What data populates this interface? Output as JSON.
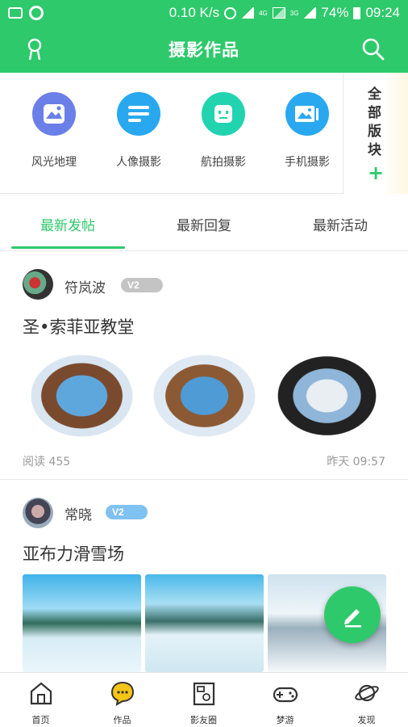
{
  "status_bar": {
    "speed": "0.10 K/s",
    "net1": "4G",
    "net2": "3G",
    "battery": "74%",
    "time": "09:24"
  },
  "header": {
    "title": "摄影作品",
    "left_icon": "user-icon",
    "right_icon": "search-icon",
    "color": "#2ec96b"
  },
  "categories": [
    {
      "label": "风光地理",
      "icon": "landscape-icon",
      "color": "#6b7fe8"
    },
    {
      "label": "人像摄影",
      "icon": "lines-icon",
      "color": "#29a8f0"
    },
    {
      "label": "航拍摄影",
      "icon": "drone-face-icon",
      "color": "#22d3b0"
    },
    {
      "label": "手机摄影",
      "icon": "gallery-icon",
      "color": "#29a8f0"
    }
  ],
  "all_categories": {
    "label": "全部版块",
    "plus": "+"
  },
  "tabs": [
    {
      "label": "最新发帖",
      "active": true
    },
    {
      "label": "最新回复",
      "active": false
    },
    {
      "label": "最新活动",
      "active": false
    }
  ],
  "posts": [
    {
      "author": "符岚波",
      "badge": "V2",
      "badge_color": "#c4c4c4",
      "title": "圣•索菲亚教堂",
      "reads": "阅读 455",
      "time": "昨天 09:57"
    },
    {
      "author": "常晓",
      "badge": "V2",
      "badge_color": "#7fc1f0",
      "title": "亚布力滑雪场"
    }
  ],
  "bottom_nav": [
    {
      "label": "首页",
      "icon": "home-icon"
    },
    {
      "label": "作品",
      "icon": "chat-bubble-icon"
    },
    {
      "label": "影友圈",
      "icon": "album-icon"
    },
    {
      "label": "梦游",
      "icon": "gamepad-icon"
    },
    {
      "label": "发现",
      "icon": "planet-icon"
    }
  ]
}
